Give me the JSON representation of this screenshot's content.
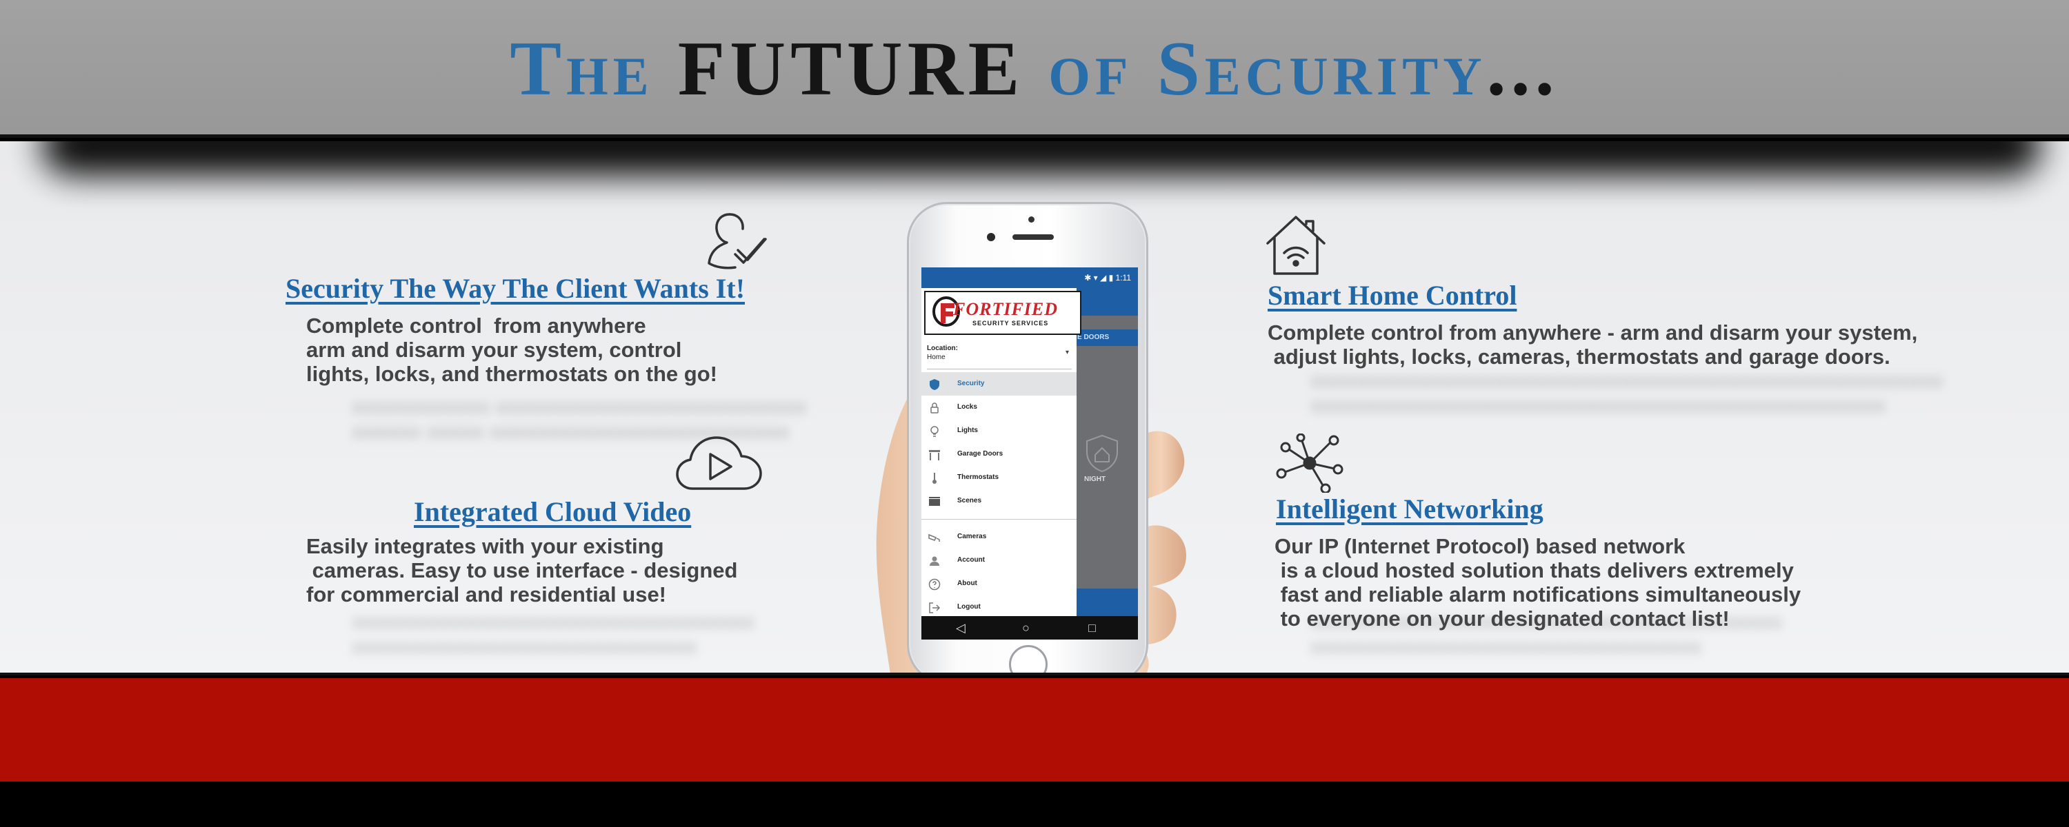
{
  "headline": {
    "part1": "The ",
    "part2": "FUTURE",
    "part3": " of Security",
    "part4": "..."
  },
  "features": {
    "client": {
      "title": "Security The Way The Client Wants It!",
      "body": "Complete control  from anywhere\narm and disarm your system, control\nlights, locks, and thermostats on the go!"
    },
    "cloud": {
      "title": "Integrated Cloud Video",
      "body": "Easily integrates with your existing\n cameras. Easy to use interface - designed\nfor commercial and residential use!"
    },
    "smart_home": {
      "title": "Smart Home Control",
      "body": "Complete control from anywhere - arm and disarm your system,\n adjust lights, locks, cameras, thermostats and garage doors."
    },
    "networking": {
      "title": "Intelligent Networking",
      "body": "Our IP (Internet Protocol) based network\n is a cloud hosted solution thats delivers extremely\n fast and reliable alarm notifications simultaneously\n to everyone on your designated contact list!"
    }
  },
  "phone": {
    "status_time": "1:11",
    "logo_text": "FORTIFIED",
    "logo_sub": "SECURITY SERVICES",
    "location_label": "Location:",
    "location_value": "Home",
    "tab_text": "E DOORS",
    "night_label": "NIGHT",
    "menu": [
      {
        "label": "Security",
        "icon": "shield-icon",
        "active": true
      },
      {
        "label": "Locks",
        "icon": "lock-icon"
      },
      {
        "label": "Lights",
        "icon": "lightbulb-icon"
      },
      {
        "label": "Garage Doors",
        "icon": "garage-icon"
      },
      {
        "label": "Thermostats",
        "icon": "thermometer-icon"
      },
      {
        "label": "Scenes",
        "icon": "scenes-icon"
      },
      {
        "label": "Cameras",
        "icon": "camera-icon"
      },
      {
        "label": "Account",
        "icon": "account-icon"
      },
      {
        "label": "About",
        "icon": "help-icon"
      },
      {
        "label": "Logout",
        "icon": "logout-icon"
      }
    ]
  },
  "colors": {
    "brand_blue": "#2a6ea9",
    "brand_red": "#b00e05",
    "header_gray": "#9e9e9e"
  }
}
